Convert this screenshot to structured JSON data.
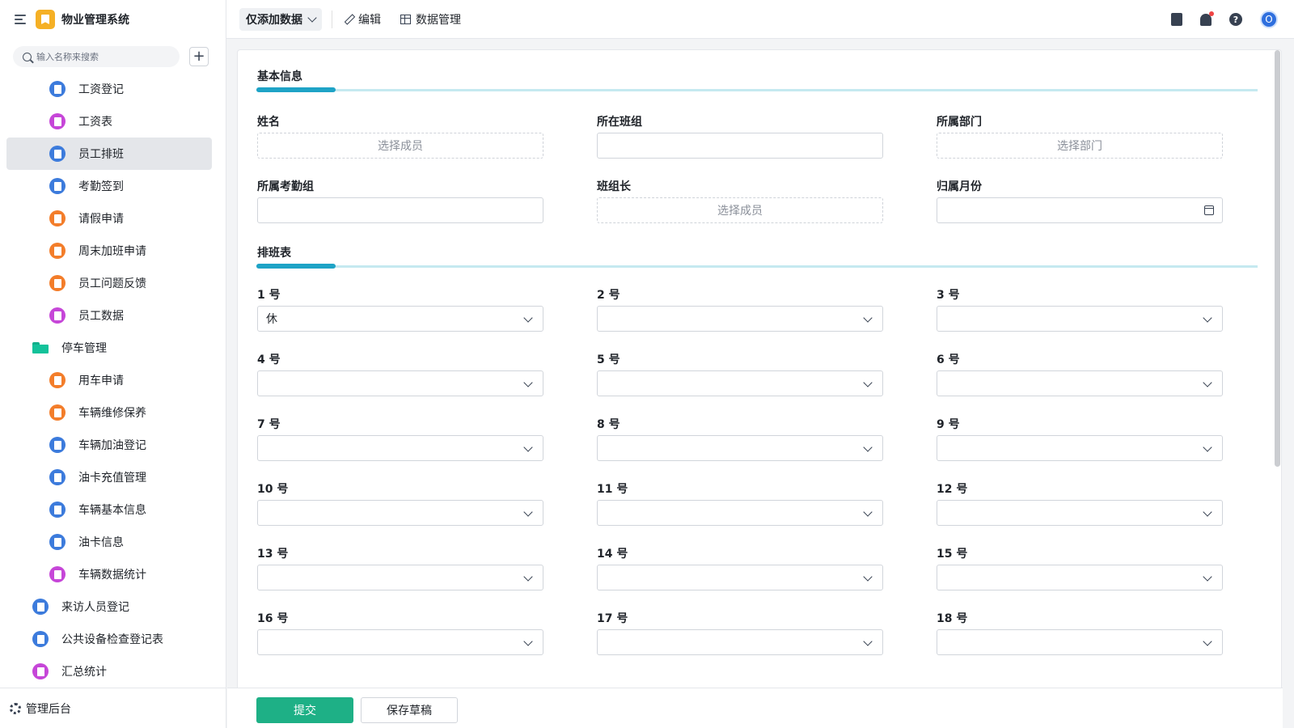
{
  "app": {
    "title": "物业管理系统"
  },
  "sidebar": {
    "search_placeholder": "输入名称来搜索",
    "add_label": "+",
    "items": [
      {
        "label": "工资登记",
        "icon": "home-icon",
        "color": "#3c7bdc",
        "level": 2
      },
      {
        "label": "工资表",
        "icon": "chart-icon",
        "color": "#c646d8",
        "level": 2
      },
      {
        "label": "员工排班",
        "icon": "document-icon",
        "color": "#3c7bdc",
        "level": 2,
        "active": true
      },
      {
        "label": "考勤签到",
        "icon": "document-icon",
        "color": "#3c7bdc",
        "level": 2
      },
      {
        "label": "请假申请",
        "icon": "clipboard-icon",
        "color": "#f37d2a",
        "level": 2
      },
      {
        "label": "周末加班申请",
        "icon": "clipboard-icon",
        "color": "#f37d2a",
        "level": 2
      },
      {
        "label": "员工问题反馈",
        "icon": "clipboard-icon",
        "color": "#f37d2a",
        "level": 2
      },
      {
        "label": "员工数据",
        "icon": "chart-icon",
        "color": "#c646d8",
        "level": 2
      },
      {
        "label": "停车管理",
        "icon": "folder-icon",
        "color": "#13c29a",
        "level": 1
      },
      {
        "label": "用车申请",
        "icon": "truck-icon",
        "color": "#f37d2a",
        "level": 2
      },
      {
        "label": "车辆维修保养",
        "icon": "target-icon",
        "color": "#f37d2a",
        "level": 2
      },
      {
        "label": "车辆加油登记",
        "icon": "document-icon",
        "color": "#3c7bdc",
        "level": 2
      },
      {
        "label": "油卡充值管理",
        "icon": "document-icon",
        "color": "#3c7bdc",
        "level": 2
      },
      {
        "label": "车辆基本信息",
        "icon": "document-icon",
        "color": "#3c7bdc",
        "level": 2
      },
      {
        "label": "油卡信息",
        "icon": "document-icon",
        "color": "#3c7bdc",
        "level": 2
      },
      {
        "label": "车辆数据统计",
        "icon": "chart-icon",
        "color": "#c646d8",
        "level": 2
      },
      {
        "label": "来访人员登记",
        "icon": "document-icon",
        "color": "#3c7bdc",
        "level": 1
      },
      {
        "label": "公共设备检查登记表",
        "icon": "document-icon",
        "color": "#3c7bdc",
        "level": 1
      },
      {
        "label": "汇总统计",
        "icon": "chart-icon",
        "color": "#c646d8",
        "level": 1
      }
    ],
    "admin_label": "管理后台"
  },
  "toolbar": {
    "mode_label": "仅添加数据",
    "edit_label": "编辑",
    "data_label": "数据管理",
    "avatar_initial": "O"
  },
  "form": {
    "section1_title": "基本信息",
    "name_label": "姓名",
    "name_placeholder": "选择成员",
    "team_label": "所在班组",
    "team_value": "",
    "dept_label": "所属部门",
    "dept_placeholder": "选择部门",
    "attendance_label": "所属考勤组",
    "attendance_value": "",
    "leader_label": "班组长",
    "leader_placeholder": "选择成员",
    "month_label": "归属月份",
    "month_value": "",
    "section2_title": "排班表",
    "days": [
      {
        "label": "1 号",
        "value": "休"
      },
      {
        "label": "2 号",
        "value": ""
      },
      {
        "label": "3 号",
        "value": ""
      },
      {
        "label": "4 号",
        "value": ""
      },
      {
        "label": "5 号",
        "value": ""
      },
      {
        "label": "6 号",
        "value": ""
      },
      {
        "label": "7 号",
        "value": ""
      },
      {
        "label": "8 号",
        "value": ""
      },
      {
        "label": "9 号",
        "value": ""
      },
      {
        "label": "10 号",
        "value": ""
      },
      {
        "label": "11 号",
        "value": ""
      },
      {
        "label": "12 号",
        "value": ""
      },
      {
        "label": "13 号",
        "value": ""
      },
      {
        "label": "14 号",
        "value": ""
      },
      {
        "label": "15 号",
        "value": ""
      },
      {
        "label": "16 号",
        "value": ""
      },
      {
        "label": "17 号",
        "value": ""
      },
      {
        "label": "18 号",
        "value": ""
      }
    ]
  },
  "footer": {
    "submit_label": "提交",
    "draft_label": "保存草稿"
  },
  "colors": {
    "accent": "#1eb086",
    "section_bar": "#1ea3c6",
    "primary": "#2f6fde"
  }
}
